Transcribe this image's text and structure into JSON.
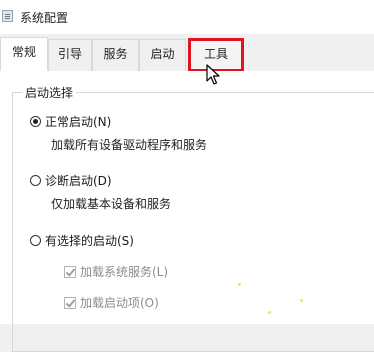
{
  "window": {
    "title": "系统配置",
    "icon": "system-config-icon"
  },
  "tabs": [
    {
      "label": "常规",
      "active": true
    },
    {
      "label": "引导",
      "active": false
    },
    {
      "label": "服务",
      "active": false
    },
    {
      "label": "启动",
      "active": false
    },
    {
      "label": "工具",
      "active": false,
      "highlighted": true
    }
  ],
  "highlight_color": "#e0141e",
  "startup_selection": {
    "label": "启动选择",
    "options": [
      {
        "label": "正常启动(N)",
        "description": "加载所有设备驱动程序和服务",
        "selected": true
      },
      {
        "label": "诊断启动(D)",
        "description": "仅加载基本设备和服务",
        "selected": false
      },
      {
        "label": "有选择的启动(S)",
        "selected": false
      }
    ],
    "selective_items": [
      {
        "label": "加载系统服务(L)",
        "checked": true,
        "enabled": false
      },
      {
        "label": "加载启动项(O)",
        "checked": true,
        "enabled": false
      }
    ]
  },
  "cursor": "arrow-cursor-icon"
}
